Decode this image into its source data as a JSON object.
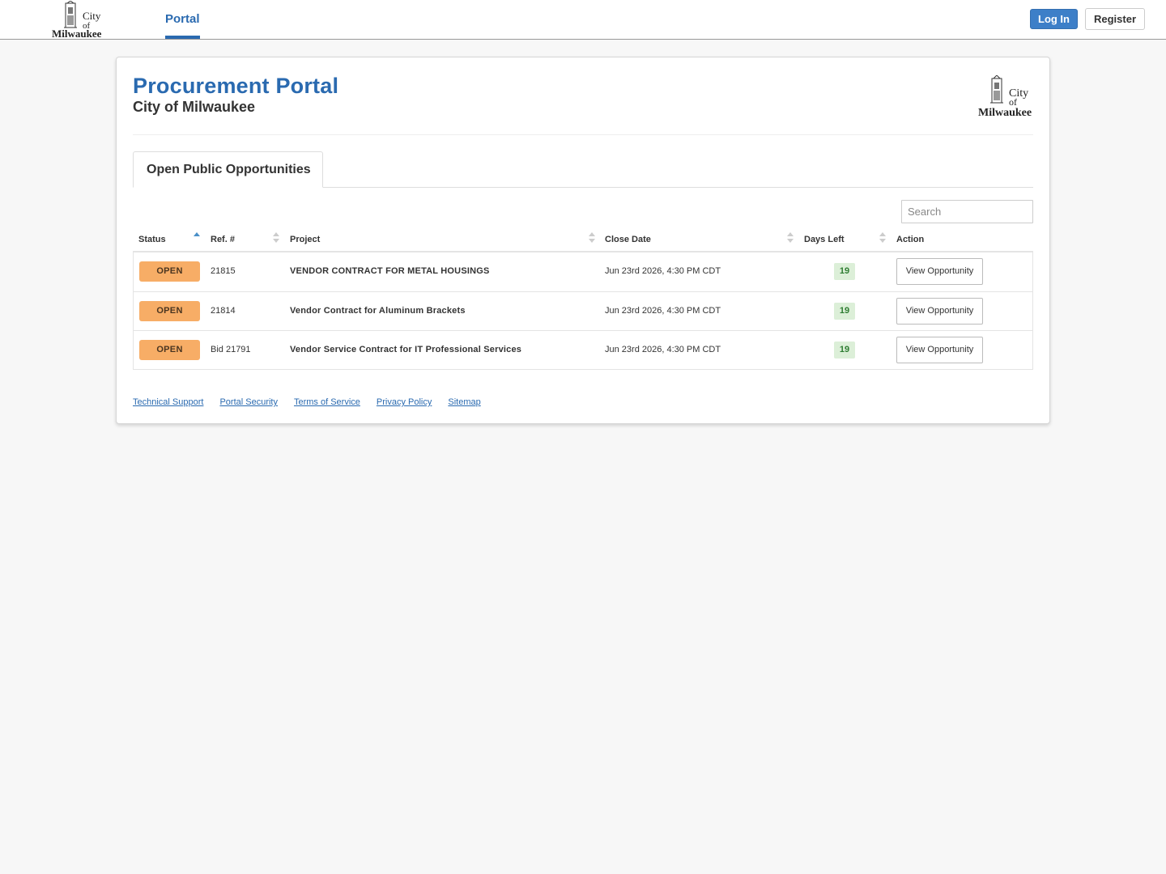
{
  "nav": {
    "logo_alt": "City of Milwaukee",
    "portal_label": "Portal",
    "login_label": "Log In",
    "register_label": "Register"
  },
  "header": {
    "title": "Procurement Portal",
    "subtitle": "City of Milwaukee",
    "logo_alt": "City of Milwaukee"
  },
  "tab": {
    "label": "Open Public Opportunities"
  },
  "search": {
    "placeholder": "Search"
  },
  "table": {
    "columns": [
      "Status",
      "Ref. #",
      "Project",
      "Close Date",
      "Days Left",
      "Action"
    ],
    "sort_column": "Status",
    "sort_direction": "ascending",
    "rows": [
      {
        "status": "OPEN",
        "ref": "21815",
        "project": "VENDOR CONTRACT FOR METAL HOUSINGS",
        "close_date": "Jun 23rd 2026, 4:30 PM CDT",
        "days_left": "19",
        "action": "View Opportunity"
      },
      {
        "status": "OPEN",
        "ref": "21814",
        "project": "Vendor Contract for Aluminum Brackets",
        "close_date": "Jun 23rd 2026, 4:30 PM CDT",
        "days_left": "19",
        "action": "View Opportunity"
      },
      {
        "status": "OPEN",
        "ref": "Bid 21791",
        "project": "Vendor Service Contract for IT Professional Services",
        "close_date": "Jun 23rd 2026, 4:30 PM CDT",
        "days_left": "19",
        "action": "View Opportunity"
      }
    ]
  },
  "footer": {
    "links": [
      "Technical Support",
      "Portal Security",
      "Terms of Service",
      "Privacy Policy",
      "Sitemap"
    ]
  },
  "colors": {
    "brand_blue": "#2a6ab0",
    "open_badge": "#f7ad66",
    "days_badge_bg": "#dcefd8",
    "days_badge_text": "#2e7d32"
  }
}
